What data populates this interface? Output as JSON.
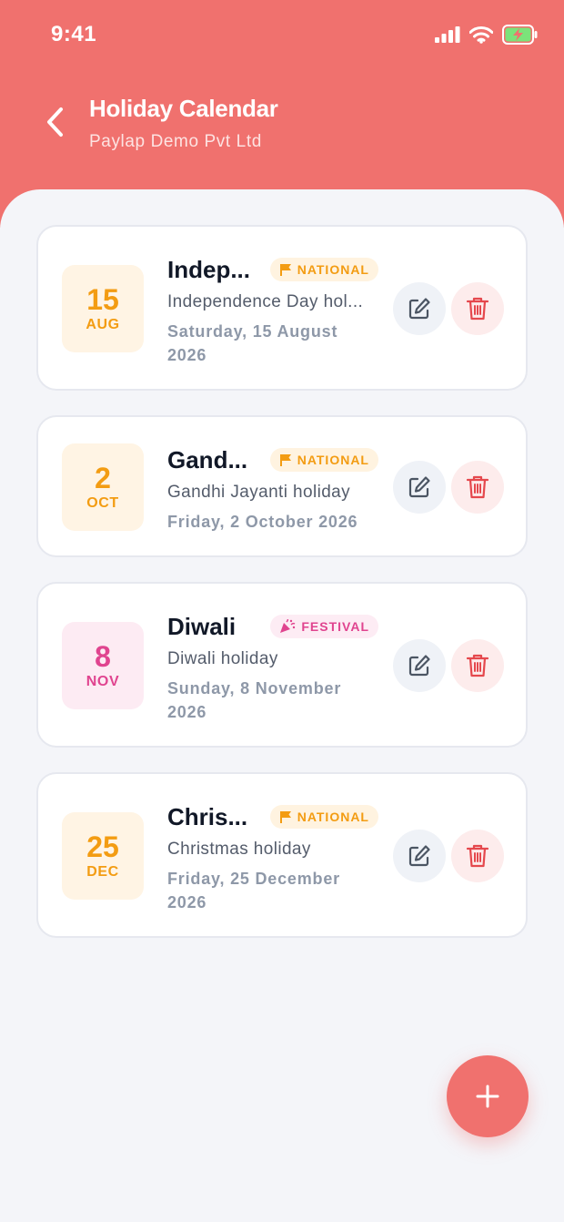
{
  "status_bar": {
    "time": "9:41"
  },
  "header": {
    "title": "Holiday Calendar",
    "subtitle": "Paylap Demo Pvt Ltd"
  },
  "colors": {
    "brand": "#f0716e",
    "national": "#f39c12",
    "festival": "#e0448f",
    "delete": "#e5484d"
  },
  "holidays": [
    {
      "day": "15",
      "month": "AUG",
      "name": "Indep...",
      "type": "NATIONAL",
      "type_icon": "flag-icon",
      "description": "Independence Day hol...",
      "date_line1": "Saturday, 15 August",
      "date_line2": "2026"
    },
    {
      "day": "2",
      "month": "OCT",
      "name": "Gand...",
      "type": "NATIONAL",
      "type_icon": "flag-icon",
      "description": "Gandhi Jayanti holiday",
      "date_line1": "Friday, 2 October 2026",
      "date_line2": ""
    },
    {
      "day": "8",
      "month": "NOV",
      "name": "Diwali",
      "type": "FESTIVAL",
      "type_icon": "party-popper-icon",
      "description": "Diwali holiday",
      "date_line1": "Sunday, 8 November",
      "date_line2": "2026"
    },
    {
      "day": "25",
      "month": "DEC",
      "name": "Chris...",
      "type": "NATIONAL",
      "type_icon": "flag-icon",
      "description": "Christmas holiday",
      "date_line1": "Friday, 25 December",
      "date_line2": "2026"
    }
  ],
  "actions": {
    "edit_icon": "edit-icon",
    "delete_icon": "trash-icon",
    "add_icon": "plus-icon"
  }
}
